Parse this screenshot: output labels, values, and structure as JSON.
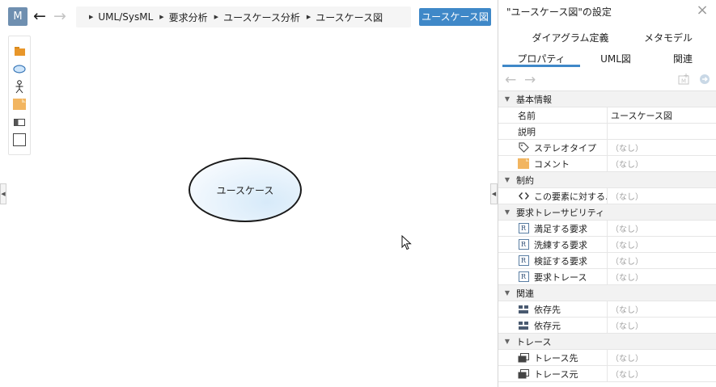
{
  "topbar": {
    "app_icon": "M",
    "back_icon": "←",
    "forward_icon": "→",
    "breadcrumb": [
      "UML/SysML",
      "要求分析",
      "ユースケース分析",
      "ユースケース図"
    ],
    "diagram_button": "ユースケース図"
  },
  "palette": {
    "items": [
      "package-icon",
      "usecase-icon",
      "actor-icon",
      "note-icon",
      "boundary-icon",
      "frame-icon"
    ]
  },
  "canvas": {
    "usecase_label": "ユースケース"
  },
  "panel": {
    "title": "\"ユースケース図\"の設定",
    "close": "×",
    "tabs_row1": [
      "ダイアグラム定義",
      "メタモデル"
    ],
    "tabs_row2": [
      "プロパティ",
      "UML図",
      "関連"
    ],
    "active_tab": "プロパティ",
    "sections": [
      {
        "label": "基本情報",
        "rows": [
          {
            "key": "名前",
            "value": "ユースケース図",
            "icon": "",
            "none": false
          },
          {
            "key": "説明",
            "value": "",
            "icon": "",
            "none": false
          },
          {
            "key": "ステレオタイプ",
            "value": "（なし）",
            "icon": "tag-icon",
            "none": true
          },
          {
            "key": "コメント",
            "value": "（なし）",
            "icon": "note-icon",
            "none": true
          }
        ]
      },
      {
        "label": "制約",
        "rows": [
          {
            "key": "この要素に対する…",
            "value": "（なし）",
            "icon": "code-icon",
            "none": true
          }
        ]
      },
      {
        "label": "要求トレーサビリティ",
        "rows": [
          {
            "key": "満足する要求",
            "value": "（なし）",
            "icon": "requirement-icon",
            "none": true
          },
          {
            "key": "洗練する要求",
            "value": "（なし）",
            "icon": "requirement-icon",
            "none": true
          },
          {
            "key": "検証する要求",
            "value": "（なし）",
            "icon": "requirement-icon",
            "none": true
          },
          {
            "key": "要求トレース",
            "value": "（なし）",
            "icon": "requirement-icon",
            "none": true
          }
        ]
      },
      {
        "label": "関連",
        "rows": [
          {
            "key": "依存先",
            "value": "（なし）",
            "icon": "dependency-icon",
            "none": true
          },
          {
            "key": "依存元",
            "value": "（なし）",
            "icon": "dependency-icon",
            "none": true
          }
        ]
      },
      {
        "label": "トレース",
        "rows": [
          {
            "key": "トレース先",
            "value": "（なし）",
            "icon": "trace-icon",
            "none": true
          },
          {
            "key": "トレース元",
            "value": "（なし）",
            "icon": "trace-icon",
            "none": true
          }
        ]
      }
    ]
  },
  "colors": {
    "accent": "#3f88c8",
    "app_icon_bg": "#6f8fb0"
  }
}
